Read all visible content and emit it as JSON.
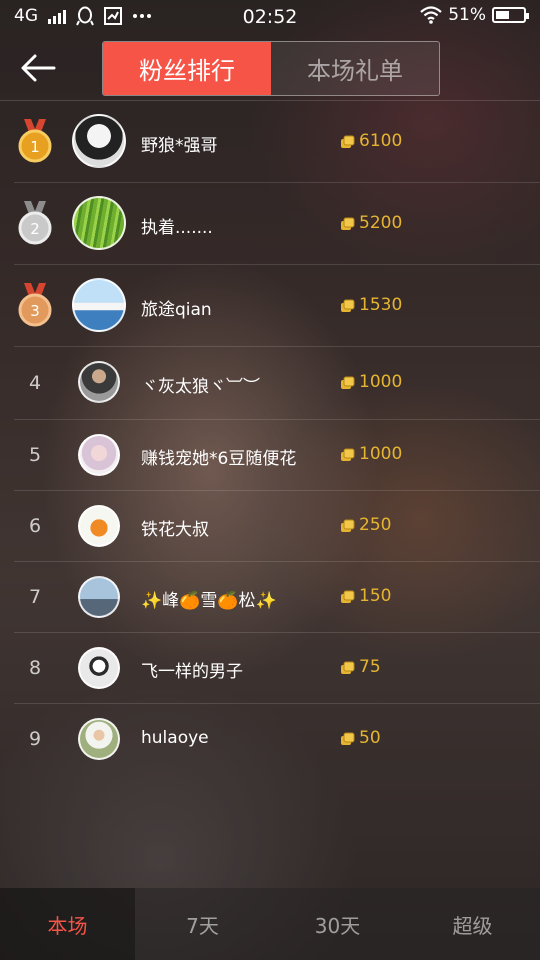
{
  "status_bar": {
    "network": "4G",
    "time": "02:52",
    "battery": "51%",
    "battery_level": 0.51,
    "icons": [
      "signal-icon",
      "qq-icon",
      "stock-icon",
      "more-dots-icon",
      "wifi-icon",
      "battery-icon"
    ]
  },
  "header": {
    "tabs": [
      {
        "label": "粉丝排行",
        "active": true
      },
      {
        "label": "本场礼单",
        "active": false
      }
    ]
  },
  "ranking": [
    {
      "rank": "1",
      "medal": "gold",
      "name": "野狼*强哥",
      "amount": "6100"
    },
    {
      "rank": "2",
      "medal": "silver",
      "name": "执着.......",
      "amount": "5200"
    },
    {
      "rank": "3",
      "medal": "bronze",
      "name": "旅途qian",
      "amount": "1530"
    },
    {
      "rank": "4",
      "name": "ヾ灰太狼ヾ︺︶",
      "amount": "1000"
    },
    {
      "rank": "5",
      "name": "赚钱宠她*6豆随便花",
      "amount": "1000"
    },
    {
      "rank": "6",
      "name": "铁花大叔",
      "amount": "250"
    },
    {
      "rank": "7",
      "name": "✨峰🍊雪🍊松✨",
      "amount": "150"
    },
    {
      "rank": "8",
      "name": "飞一样的男子",
      "amount": "75"
    },
    {
      "rank": "9",
      "name": "hulaoye",
      "amount": "50"
    }
  ],
  "bottom_tabs": [
    {
      "label": "本场",
      "active": true
    },
    {
      "label": "7天",
      "active": false
    },
    {
      "label": "30天",
      "active": false
    },
    {
      "label": "超级",
      "active": false
    }
  ],
  "colors": {
    "accent": "#f55446",
    "amount": "#e5b531",
    "gold": "#e8a020",
    "silver": "#c9c9c9",
    "bronze": "#e29a5c"
  }
}
